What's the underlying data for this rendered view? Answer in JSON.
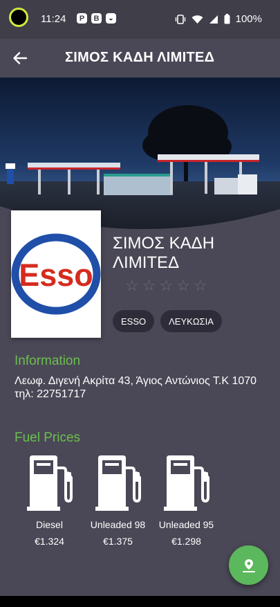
{
  "status_bar": {
    "time": "11:24",
    "app_icons": [
      "P",
      "B",
      "◒"
    ],
    "battery_percent": "100%"
  },
  "app_bar": {
    "title": "ΣΙΜΟΣ ΚΑΔΗ ΛΙΜΙΤΕΔ"
  },
  "station": {
    "name": "ΣΙΜΟΣ ΚΑΔΗ ΛΙΜΙΤΕΔ",
    "logo_text": "Esso",
    "rating": 0,
    "rating_max": 5,
    "tags": [
      "ESSO",
      "ΛΕΥΚΩΣΙΑ"
    ]
  },
  "information": {
    "heading": "Information",
    "address": "Λεωφ. Διγενή Ακρίτα 43, Άγιος Αντώνιος Τ.Κ 1070\n τηλ: 22751717"
  },
  "fuel_prices": {
    "heading": "Fuel Prices",
    "items": [
      {
        "name": "Diesel",
        "price": "€1.324"
      },
      {
        "name": "Unleaded 98",
        "price": "€1.375"
      },
      {
        "name": "Unleaded 95",
        "price": "€1.298"
      }
    ]
  },
  "colors": {
    "accent_green": "#6cbf4f",
    "fab_green": "#5cb85c",
    "background": "#4a4856",
    "status_bar": "#3f3e49",
    "esso_red": "#d52b1e",
    "esso_blue": "#1f4fa8"
  },
  "icons": {
    "back": "arrow-left-icon",
    "fab": "map-pin-icon",
    "fuel": "fuel-pump-icon",
    "star": "star-outline-icon"
  }
}
